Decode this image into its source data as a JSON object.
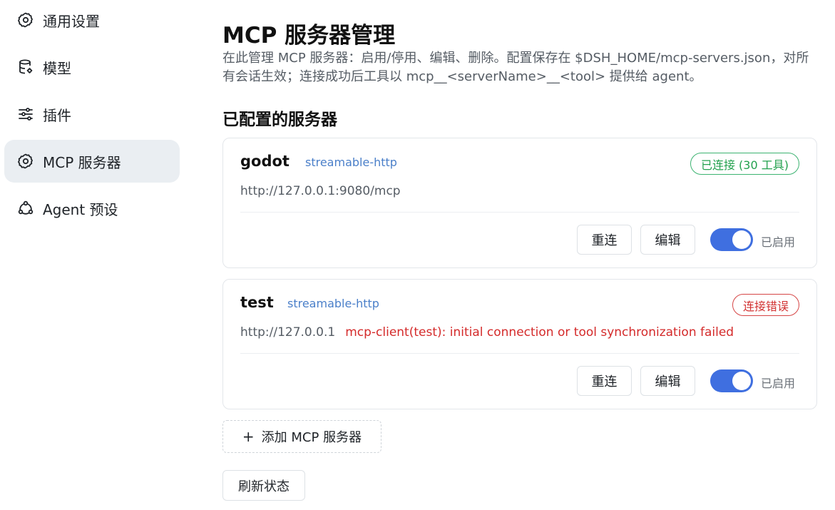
{
  "sidebar": {
    "items": [
      {
        "label": "通用设置",
        "icon": "gear-icon"
      },
      {
        "label": "模型",
        "icon": "database-icon"
      },
      {
        "label": "插件",
        "icon": "sliders-icon"
      },
      {
        "label": "MCP 服务器",
        "icon": "gear-icon",
        "active": true
      },
      {
        "label": "Agent 预设",
        "icon": "network-icon"
      }
    ]
  },
  "main": {
    "title": "MCP 服务器管理",
    "description": "在此管理 MCP 服务器：启用/停用、编辑、删除。配置保存在 $DSH_HOME/mcp-servers.json，对所有会话生效；连接成功后工具以 mcp__<serverName>__<tool> 提供给 agent。",
    "section_title": "已配置的服务器",
    "servers": [
      {
        "name": "godot",
        "transport": "streamable-http",
        "status": "已连接 (30 工具)",
        "status_type": "ok",
        "url": "http://127.0.0.1:9080/mcp",
        "error": "",
        "reconnect_label": "重连",
        "edit_label": "编辑",
        "enabled": true,
        "enabled_label": "已启用"
      },
      {
        "name": "test",
        "transport": "streamable-http",
        "status": "连接错误",
        "status_type": "error",
        "url": "http://127.0.0.1",
        "error": "mcp-client(test): initial connection or tool synchronization failed",
        "reconnect_label": "重连",
        "edit_label": "编辑",
        "enabled": true,
        "enabled_label": "已启用"
      }
    ],
    "add_button_label": "添加 MCP 服务器",
    "refresh_button_label": "刷新状态"
  },
  "colors": {
    "accent": "#3f6fe0",
    "success": "#23a14e",
    "error": "#d23232",
    "link": "#4a7fc9"
  }
}
